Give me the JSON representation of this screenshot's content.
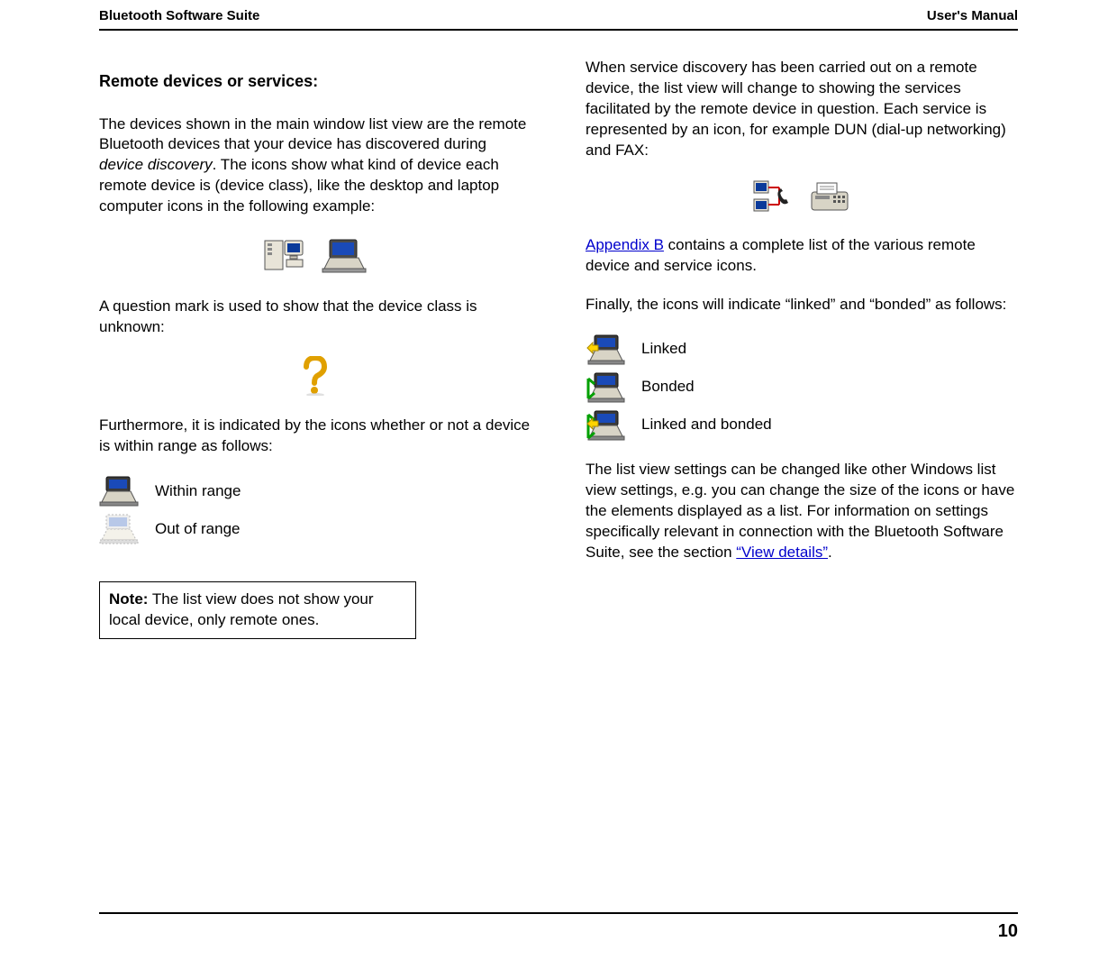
{
  "header": {
    "left": "Bluetooth Software Suite",
    "right": "User's Manual"
  },
  "page_number": "10",
  "left_col": {
    "title": "Remote devices or services:",
    "p1_a": "The devices shown in the main window list view are the remote Bluetooth devices that your device has discovered during ",
    "p1_italic": "device discovery",
    "p1_b": ". The icons show what kind of device each remote device is (device class), like the desktop and laptop computer icons in the following example:",
    "p2": "A question mark is used to show that the device class is unknown:",
    "p3": "Furthermore, it is indicated by the icons whether or not a device is within range as follows:",
    "range_rows": [
      {
        "label": "Within range"
      },
      {
        "label": "Out of range"
      }
    ],
    "note_label": "Note:",
    "note_text": " The list view does not show your local device, only remote ones."
  },
  "right_col": {
    "p1": "When service discovery has been carried out on a remote device, the list view will change to showing the services facilitated by the remote device in question. Each service is represented by an icon, for example DUN (dial-up networking) and FAX:",
    "p2_link": "Appendix B",
    "p2_rest": " contains a complete list of the various remote device and service icons.",
    "p3": "Finally, the icons will indicate “linked” and “bonded” as follows:",
    "status_rows": [
      {
        "label": "Linked"
      },
      {
        "label": "Bonded"
      },
      {
        "label": "Linked and bonded"
      }
    ],
    "p4_a": "The list view settings can be changed like other Windows list view settings, e.g. you can change the size of the icons or have the elements displayed as a list. For information on settings specifically relevant in connection with the Bluetooth Software Suite, see the section ",
    "p4_link": "“View details”",
    "p4_b": "."
  }
}
